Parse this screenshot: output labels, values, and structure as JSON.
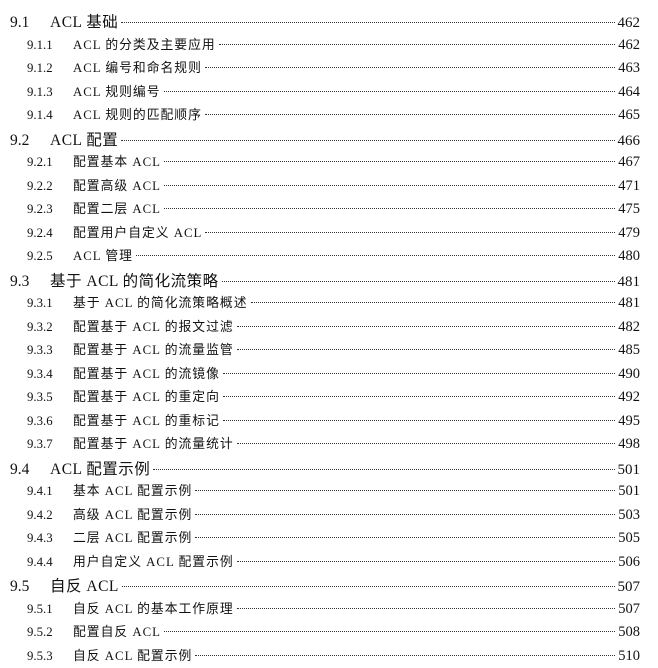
{
  "toc": [
    {
      "level": 1,
      "num": "9.1",
      "title": "ACL 基础",
      "page": "462"
    },
    {
      "level": 2,
      "num": "9.1.1",
      "title": "ACL 的分类及主要应用",
      "page": "462"
    },
    {
      "level": 2,
      "num": "9.1.2",
      "title": "ACL 编号和命名规则",
      "page": "463"
    },
    {
      "level": 2,
      "num": "9.1.3",
      "title": "ACL 规则编号",
      "page": "464"
    },
    {
      "level": 2,
      "num": "9.1.4",
      "title": "ACL 规则的匹配顺序",
      "page": "465"
    },
    {
      "level": 1,
      "num": "9.2",
      "title": "ACL 配置",
      "page": "466"
    },
    {
      "level": 2,
      "num": "9.2.1",
      "title": "配置基本 ACL",
      "page": "467"
    },
    {
      "level": 2,
      "num": "9.2.2",
      "title": "配置高级 ACL",
      "page": "471"
    },
    {
      "level": 2,
      "num": "9.2.3",
      "title": "配置二层 ACL",
      "page": "475"
    },
    {
      "level": 2,
      "num": "9.2.4",
      "title": "配置用户自定义 ACL",
      "page": "479"
    },
    {
      "level": 2,
      "num": "9.2.5",
      "title": "ACL 管理",
      "page": "480"
    },
    {
      "level": 1,
      "num": "9.3",
      "title": "基于 ACL 的简化流策略",
      "page": "481"
    },
    {
      "level": 2,
      "num": "9.3.1",
      "title": "基于 ACL 的简化流策略概述",
      "page": "481"
    },
    {
      "level": 2,
      "num": "9.3.2",
      "title": "配置基于 ACL 的报文过滤",
      "page": "482"
    },
    {
      "level": 2,
      "num": "9.3.3",
      "title": "配置基于 ACL 的流量监管",
      "page": "485"
    },
    {
      "level": 2,
      "num": "9.3.4",
      "title": "配置基于 ACL 的流镜像",
      "page": "490"
    },
    {
      "level": 2,
      "num": "9.3.5",
      "title": "配置基于 ACL 的重定向",
      "page": "492"
    },
    {
      "level": 2,
      "num": "9.3.6",
      "title": "配置基于 ACL 的重标记",
      "page": "495"
    },
    {
      "level": 2,
      "num": "9.3.7",
      "title": "配置基于 ACL 的流量统计",
      "page": "498"
    },
    {
      "level": 1,
      "num": "9.4",
      "title": "ACL 配置示例",
      "page": "501"
    },
    {
      "level": 2,
      "num": "9.4.1",
      "title": "基本 ACL 配置示例",
      "page": "501"
    },
    {
      "level": 2,
      "num": "9.4.2",
      "title": "高级 ACL 配置示例",
      "page": "503"
    },
    {
      "level": 2,
      "num": "9.4.3",
      "title": "二层 ACL 配置示例",
      "page": "505"
    },
    {
      "level": 2,
      "num": "9.4.4",
      "title": "用户自定义 ACL 配置示例",
      "page": "506"
    },
    {
      "level": 1,
      "num": "9.5",
      "title": "自反 ACL",
      "page": "507"
    },
    {
      "level": 2,
      "num": "9.5.1",
      "title": "自反 ACL 的基本工作原理",
      "page": "507"
    },
    {
      "level": 2,
      "num": "9.5.2",
      "title": "配置自反 ACL",
      "page": "508"
    },
    {
      "level": 2,
      "num": "9.5.3",
      "title": "自反 ACL 配置示例",
      "page": "510"
    }
  ]
}
